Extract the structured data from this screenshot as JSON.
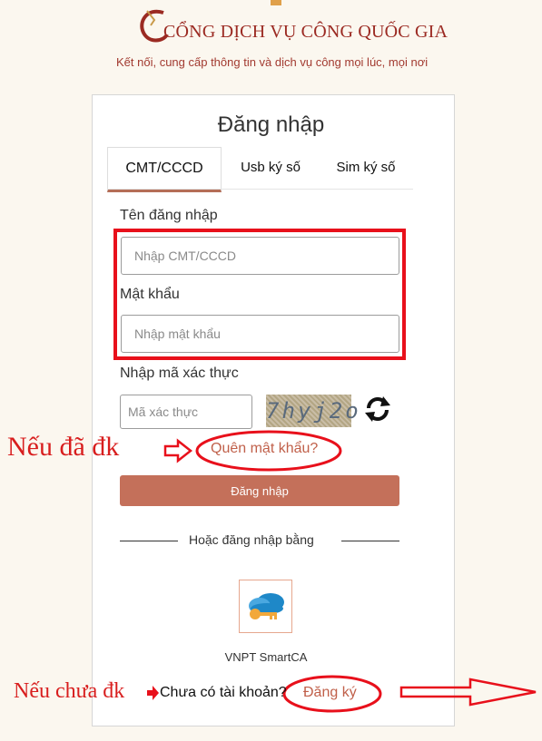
{
  "header": {
    "title": "CỔNG DỊCH VỤ CÔNG QUỐC GIA",
    "subtitle": "Kết nối, cung cấp thông tin và dịch vụ công mọi lúc, mọi nơi"
  },
  "login": {
    "title": "Đăng nhập",
    "tabs": [
      {
        "label": "CMT/CCCD",
        "active": true
      },
      {
        "label": "Usb ký số",
        "active": false
      },
      {
        "label": "Sim ký số",
        "active": false
      }
    ],
    "username_label": "Tên đăng nhập",
    "username_placeholder": "Nhập CMT/CCCD",
    "password_label": "Mật khẩu",
    "password_placeholder": "Nhập mật khẩu",
    "captcha_label": "Nhập mã xác thực",
    "captcha_placeholder": "Mã xác thực",
    "captcha_text": "7hyj2o",
    "forgot_password": "Quên mật khẩu?",
    "submit_label": "Đăng nhập",
    "alt_login_label": "Hoặc đăng nhập bằng",
    "smartca_label": "VNPT SmartCA",
    "no_account_text": "Chưa có tài khoản?",
    "register_link": "Đăng ký"
  },
  "annotations": {
    "registered_note": "Nếu đã đk",
    "unregistered_note": "Nếu chưa đk"
  },
  "colors": {
    "brand": "#9b2a22",
    "button": "#c4705a",
    "annotation": "#e8101b"
  },
  "icons": [
    "refresh-icon",
    "smartca-cloud-key-icon"
  ]
}
